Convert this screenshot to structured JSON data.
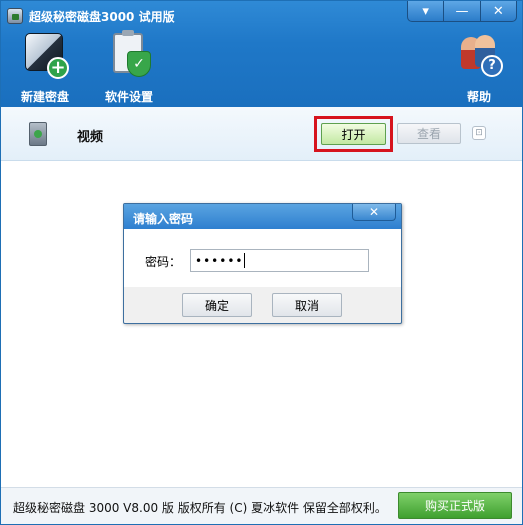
{
  "window": {
    "title": "超级秘密磁盘3000 试用版"
  },
  "window_controls": {
    "menu": "▾",
    "minimize": "—",
    "close": "✕"
  },
  "toolbar": {
    "new_disk_label": "新建密盘",
    "settings_label": "软件设置",
    "help_label": "帮助"
  },
  "disk": {
    "name": "视频",
    "open_label": "打开",
    "view_label": "查看",
    "extra_glyph": "⊡"
  },
  "dialog": {
    "title": "请输入密码",
    "close": "✕",
    "password_label": "密码：",
    "password_mask": "••••••",
    "ok_label": "确定",
    "cancel_label": "取消"
  },
  "status": {
    "copyright": "超级秘密磁盘 3000 V8.00 版  版权所有 (C)  夏冰软件 保留全部权利。",
    "buy_label": "购买正式版"
  },
  "colors": {
    "header_blue": "#1f78c8",
    "highlight_red": "#d6131d",
    "buy_green": "#3fa02f"
  }
}
